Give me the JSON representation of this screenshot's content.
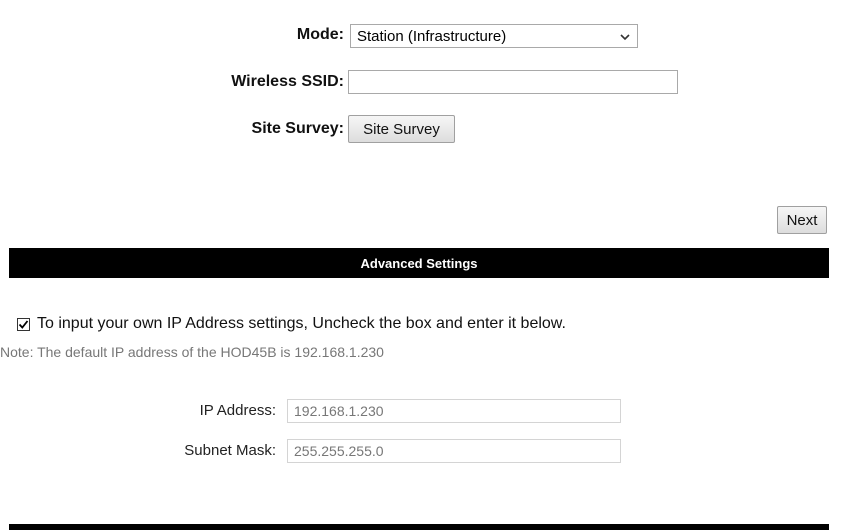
{
  "wireless": {
    "mode_label": "Mode:",
    "mode_value": "Station (Infrastructure)",
    "ssid_label": "Wireless SSID:",
    "ssid_value": "",
    "survey_label": "Site Survey:",
    "survey_button": "Site Survey"
  },
  "next_button": "Next",
  "advanced": {
    "title": "Advanced Settings",
    "checkbox_checked": true,
    "checkbox_label": "To input your own IP Address settings, Uncheck the box and enter it below.",
    "note": "Note: The default IP address of the HOD45B is 192.168.1.230",
    "ip_label": "IP Address:",
    "ip_value": "192.168.1.230",
    "subnet_label": "Subnet Mask:",
    "subnet_value": "255.255.255.0"
  }
}
